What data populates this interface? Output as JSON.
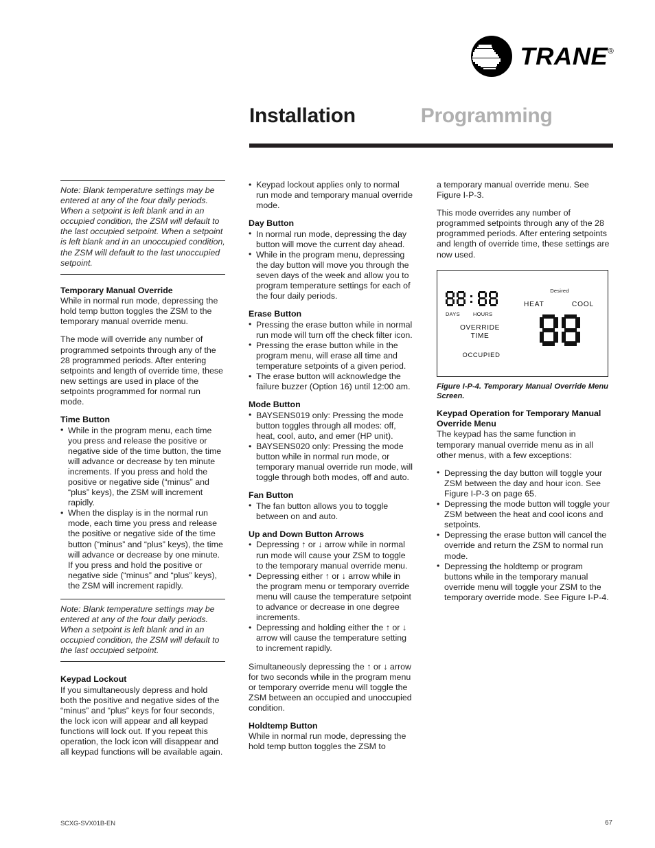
{
  "brand": {
    "name": "TRANE",
    "registered_mark": "®"
  },
  "header": {
    "title_main": "Installation",
    "title_sub": "Programming"
  },
  "column1": {
    "note_top": "Note: Blank temperature settings may be entered at any of the four daily periods. When a setpoint is left blank and in an occupied condition, the ZSM will default to the last occupied setpoint. When a setpoint is left blank and in an unoccupied condition, the ZSM will default to the last unoccupied  setpoint.",
    "heading_tmo": "Temporary Manual Override",
    "tmo_p1": "While in normal run mode, depressing the hold temp button toggles the ZSM to the temporary manual override menu.",
    "tmo_p2": "The mode will override any number of programmed setpoints through any of the 28 programmed periods. After entering setpoints and length of override time, these new settings are used in place of the setpoints programmed for normal run mode.",
    "heading_time": "Time Button",
    "time_bullets": [
      "While in the program menu, each time you press and release the positive or negative side of the time button, the time will advance or decrease by ten minute increments. If you press and hold the positive or negative side (“minus” and “plus” keys), the ZSM will increment rapidly.",
      "When the display is in the normal run mode, each time you press and release the positive or negative side of the time button (“minus” and “plus” keys), the time will advance or decrease by one minute. If you press and hold the positive or negative side (“minus” and “plus” keys), the ZSM will increment rapidly."
    ],
    "note_bottom": "Note: Blank temperature settings may be entered at any of the four daily periods. When a setpoint is left blank and in an occupied condition, the ZSM will default to the last occupied setpoint.",
    "heading_lockout": "Keypad Lockout",
    "lockout_p1": "If you simultaneously depress and hold both the positive and negative sides of the “minus” and “plus” keys for four seconds, the lock icon will appear and all keypad functions will lock out. If you repeat this operation, the lock icon will disappear and all keypad functions will be available again."
  },
  "column2": {
    "lockout_bullets": [
      "Keypad lockout applies only to normal run mode and temporary manual override mode."
    ],
    "heading_day": "Day Button",
    "day_bullets": [
      "In normal run mode, depressing the day button will move the current day ahead.",
      "While in the program menu, depressing the day button will move you through the seven days of the week and allow you to program temperature settings for each of the four daily periods."
    ],
    "heading_erase": "Erase Button",
    "erase_bullets": [
      "Pressing the erase button while in normal run mode will turn off the check filter icon.",
      "Pressing the erase button while in the program menu, will erase all time and temperature setpoints of a given period.",
      "The erase button will acknowledge the failure buzzer (Option 16) until 12:00 am."
    ],
    "heading_mode": "Mode Button",
    "mode_bullets": [
      "BAYSENS019 only: Pressing the mode button toggles through all modes: off, heat, cool, auto, and emer (HP unit).",
      "BAYSENS020 only: Pressing the mode button while in normal run mode, or temporary manual override run mode, will toggle through both modes, off and auto."
    ],
    "heading_fan": "Fan Button",
    "fan_bullets": [
      "The fan button allows you to toggle between on and auto."
    ],
    "heading_arrows": "Up and Down Button Arrows",
    "arrow_bullets": [
      "Depressing ↑ or ↓ arrow while in normal run mode will cause your ZSM to toggle to the temporary manual override menu.",
      "Depressing either ↑ or ↓ arrow while in the program menu or temporary override menu will cause the temperature setpoint to advance or decrease in one degree increments.",
      "Depressing and holding either the ↑ or ↓ arrow will cause the temperature setting to increment rapidly."
    ],
    "simultaneous_p": "Simultaneously depressing the ↑ or ↓ arrow for two seconds while in the program menu or temporary override menu will toggle the ZSM between an occupied and unoccupied condition.",
    "heading_holdtemp": "Holdtemp Button",
    "holdtemp_p": "While in normal run mode, depressing the hold temp button toggles the ZSM to"
  },
  "column3": {
    "continued_p": "a temporary manual override menu. See Figure I-P-3.",
    "override_p": "This mode overrides any number of programmed setpoints through any of the 28 programmed periods. After entering setpoints and length of override time, these settings are now used.",
    "figure": {
      "days_value": "88",
      "hours_value": "88",
      "colon": ":",
      "label_days": "DAYS",
      "label_hours": "HOURS",
      "label_override": "OVERRIDE",
      "label_time": "TIME",
      "label_occupied": "OCCUPIED",
      "label_desired": "Desired",
      "label_heat": "HEAT",
      "label_cool": "COOL",
      "setpoint_value": "88",
      "caption": "Figure I-P-4. Temporary Manual Override Menu Screen."
    },
    "heading_keypad_op": "Keypad Operation for Temporary Manual Override Menu",
    "keypad_op_p": "The keypad has the same function in temporary manual override menu as in all other menus, with a few exceptions:",
    "keypad_op_bullets": [
      "Depressing the day button will toggle your ZSM between the day and hour icon. See Figure I-P-3 on page 65.",
      "Depressing the mode button will toggle your ZSM between the heat and cool icons and setpoints.",
      "Depressing the erase button will cancel the override and return the ZSM to normal run mode.",
      "Depressing the holdtemp or program buttons while in the temporary manual override menu will toggle your ZSM to the temporary override mode. See Figure I-P-4."
    ]
  },
  "footer": {
    "document_code": "SCXG-SVX01B-EN",
    "page_number": "67"
  }
}
